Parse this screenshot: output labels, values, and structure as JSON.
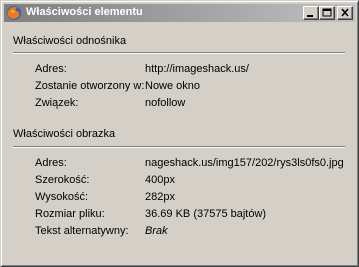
{
  "window": {
    "title": "Właściwości elementu"
  },
  "link_section": {
    "title": "Właściwości odnośnika",
    "rows": [
      {
        "label": "Adres:",
        "value": "http://imageshack.us/"
      },
      {
        "label": "Zostanie otworzony w:",
        "value": "Nowe okno"
      },
      {
        "label": "Związek:",
        "value": "nofollow"
      }
    ]
  },
  "image_section": {
    "title": "Właściwości obrazka",
    "rows": [
      {
        "label": "Adres:",
        "value": "nageshack.us/img157/202/rys3ls0fs0.jpg"
      },
      {
        "label": "Szerokość:",
        "value": "400px"
      },
      {
        "label": "Wysokość:",
        "value": "282px"
      },
      {
        "label": "Rozmiar pliku:",
        "value": "36.69 KB (37575 bajtów)"
      },
      {
        "label": "Tekst alternatywny:",
        "value": "Brak"
      }
    ]
  },
  "icons": {
    "app": "firefox-icon",
    "minimize": "minimize-icon",
    "maximize": "maximize-icon",
    "close": "close-icon"
  },
  "colors": {
    "title_gradient_start": "#7f7f7f",
    "title_gradient_end": "#c0c0c0",
    "face": "#d4d0c8"
  }
}
